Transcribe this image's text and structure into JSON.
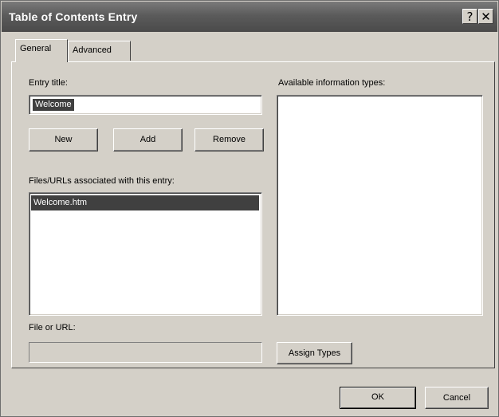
{
  "window": {
    "title": "Table of Contents Entry",
    "help_glyph": "?",
    "close_glyph": "✕"
  },
  "tabs": [
    {
      "label": "General",
      "active": true
    },
    {
      "label": "Advanced",
      "active": false
    }
  ],
  "general": {
    "entry_title_label": "Entry title:",
    "entry_title_value": "Welcome",
    "buttons": {
      "new": "New",
      "add": "Add",
      "remove": "Remove"
    },
    "associated_label": "Files/URLs associated with this entry:",
    "associated_items": [
      "Welcome.htm"
    ],
    "available_label": "Available information types:",
    "file_url_label": "File or URL:",
    "file_url_value": "",
    "assign_button": "Assign Types"
  },
  "footer": {
    "ok": "OK",
    "cancel": "Cancel"
  },
  "colors": {
    "dialog_bg": "#d4d0c8",
    "titlebar": "#5b5b5b",
    "selection": "#404040"
  }
}
